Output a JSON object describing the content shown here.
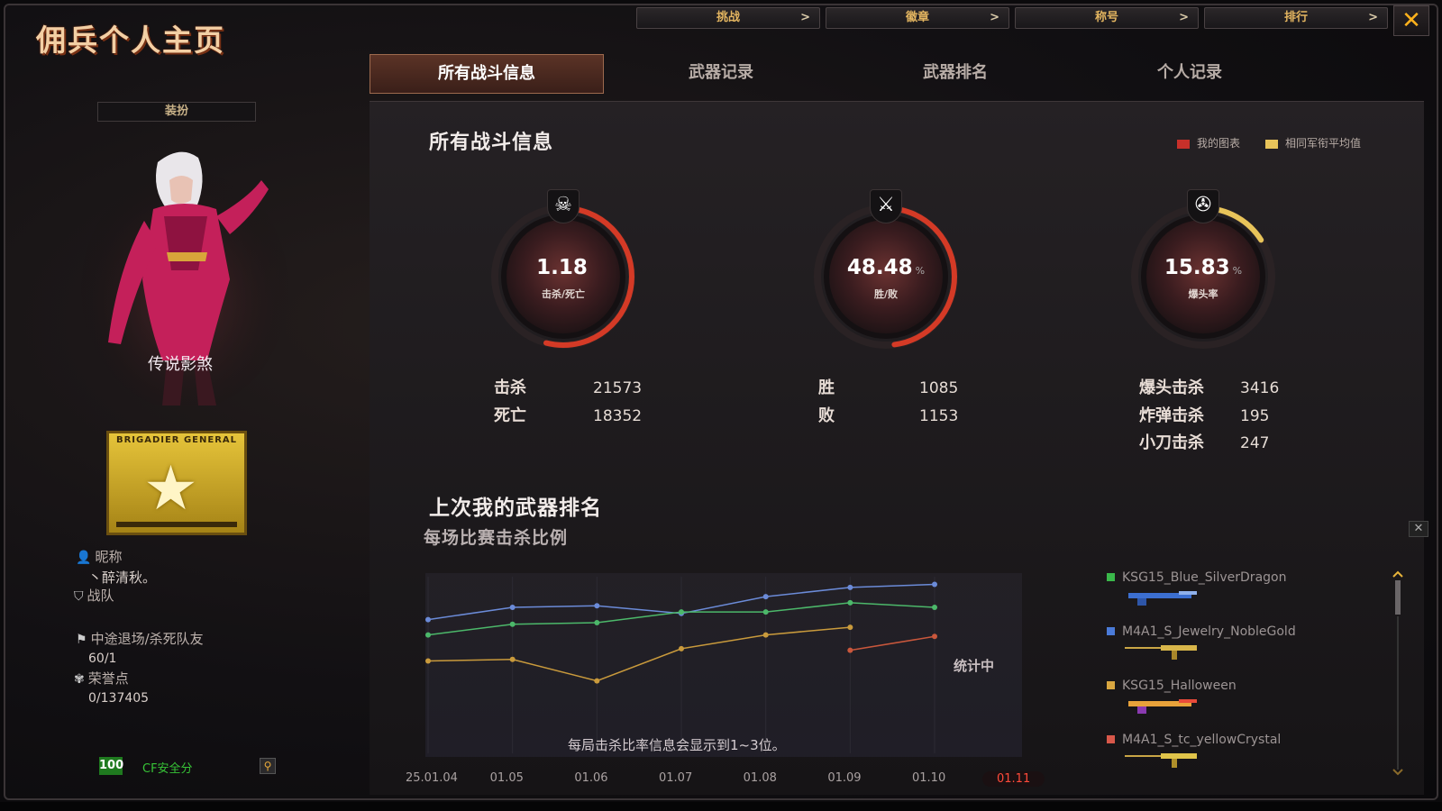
{
  "header": {
    "title": "佣兵个人主页",
    "nav": [
      {
        "label": "挑战",
        "arrow": ">"
      },
      {
        "label": "徽章",
        "arrow": ">"
      },
      {
        "label": "称号",
        "arrow": ">"
      },
      {
        "label": "排行",
        "arrow": ">"
      }
    ],
    "close": "✕"
  },
  "tabs": [
    "所有战斗信息",
    "武器记录",
    "武器排名",
    "个人记录"
  ],
  "left": {
    "dress_button": "装扮",
    "character_name": "传说影煞",
    "rank_text": "BRIGADIER GENERAL",
    "nickname_label": "昵称",
    "nickname": "丶醉清秋。",
    "clan_label": "战队",
    "quit_label": "中途退场/杀死队友",
    "quit_value": "60/1",
    "honor_label": "荣誉点",
    "honor_value": "0/137405",
    "security_score": "100",
    "security_label": "CF安全分"
  },
  "battle": {
    "title": "所有战斗信息",
    "legend": [
      {
        "label": "我的图表",
        "color": "#c8302a"
      },
      {
        "label": "相同军衔平均值",
        "color": "#e8c45a"
      }
    ],
    "gauges": [
      {
        "value": "1.18",
        "unit": "",
        "label": "击杀/死亡",
        "icon": "☠",
        "fraction": 0.54
      },
      {
        "value": "48.48",
        "unit": "%",
        "label": "胜/败",
        "icon": "⚔",
        "fraction": 0.48
      },
      {
        "value": "15.83",
        "unit": "%",
        "label": "爆头率",
        "icon": "✇",
        "fraction": 0.16
      }
    ],
    "stats": {
      "kills_label": "击杀",
      "kills": "21573",
      "deaths_label": "死亡",
      "deaths": "18352",
      "wins_label": "胜",
      "wins": "1085",
      "losses_label": "败",
      "losses": "1153",
      "headshot_label": "爆头击杀",
      "headshot": "3416",
      "bomb_label": "炸弹击杀",
      "bomb": "195",
      "knife_label": "小刀击杀",
      "knife": "247"
    }
  },
  "ranking": {
    "title": "上次我的武器排名",
    "subtitle": "每场比赛击杀比例",
    "status_label": "统计中",
    "note": "每局击杀比率信息会显示到1~3位。",
    "selected_label": "01.11"
  },
  "chart_data": {
    "type": "line",
    "categories": [
      "25.01.04",
      "01.05",
      "01.06",
      "01.07",
      "01.08",
      "01.09",
      "01.10"
    ],
    "series": [
      {
        "name": "KSG15_Blue_SilverDragon",
        "color": "#6b8bd8",
        "values": [
          0.72,
          0.8,
          0.81,
          0.76,
          0.87,
          0.93,
          0.95
        ]
      },
      {
        "name": "M4A1_S_Jewelry_NobleGold",
        "color": "#4cb86a",
        "values": [
          0.62,
          0.69,
          0.7,
          0.77,
          0.77,
          0.83,
          0.8
        ]
      },
      {
        "name": "KSG15_Halloween",
        "color": "#c99a3c",
        "values": [
          0.45,
          0.46,
          0.32,
          0.53,
          0.62,
          0.67,
          null
        ]
      },
      {
        "name": "M4A1_S_tc_yellowCrystal",
        "color": "#c9573c",
        "values": [
          null,
          null,
          null,
          null,
          null,
          0.52,
          0.61
        ]
      }
    ]
  }
}
